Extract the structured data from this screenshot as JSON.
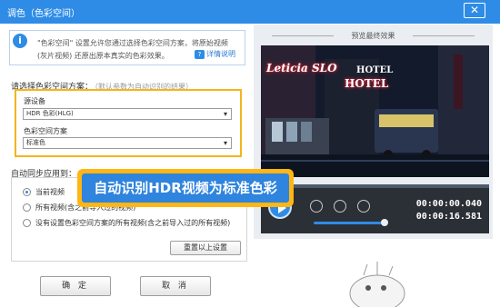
{
  "window": {
    "title": "调色（色彩空间）",
    "close_label": "✕"
  },
  "info": {
    "icon_text": "i",
    "line1": "\"色彩空间\" 设置允许您通过选择色彩空间方案，将原始视频",
    "line2": "(灰片视频) 还原出原本真实的色彩效果。",
    "help_icon_text": "?",
    "help_label": "详情说明"
  },
  "color_space": {
    "heading": "请选择色彩空间方案：",
    "hint": "（默认参数为自动识别的结果）",
    "source_device_label": "源设备",
    "source_device_value": "HDR 色彩(HLG)",
    "scheme_label": "色彩空间方案",
    "scheme_value": "标准色"
  },
  "sync": {
    "heading": "自动同步应用到：",
    "options": [
      "当前视频",
      "所有视频(含之前导入过的视频)",
      "没有设置色彩空间方案的所有视频(含之前导入过的所有视频)"
    ],
    "selected_index": 0,
    "reset_label": "重置以上设置"
  },
  "buttons": {
    "ok": "确 定",
    "cancel": "取 消"
  },
  "preview": {
    "title": "预览最终效果",
    "signs": [
      "Leticia SLO",
      "HOTEL",
      "HOTEL"
    ],
    "time_current": "00:00:00.040",
    "time_total": "00:00:16.581",
    "volume_level": 0.95
  },
  "callout": {
    "text": "自动识别HDR视频为标准色彩"
  },
  "colors": {
    "accent": "#2f8ce6",
    "highlight": "#f3b51c",
    "callout_border": "#ffb614"
  }
}
